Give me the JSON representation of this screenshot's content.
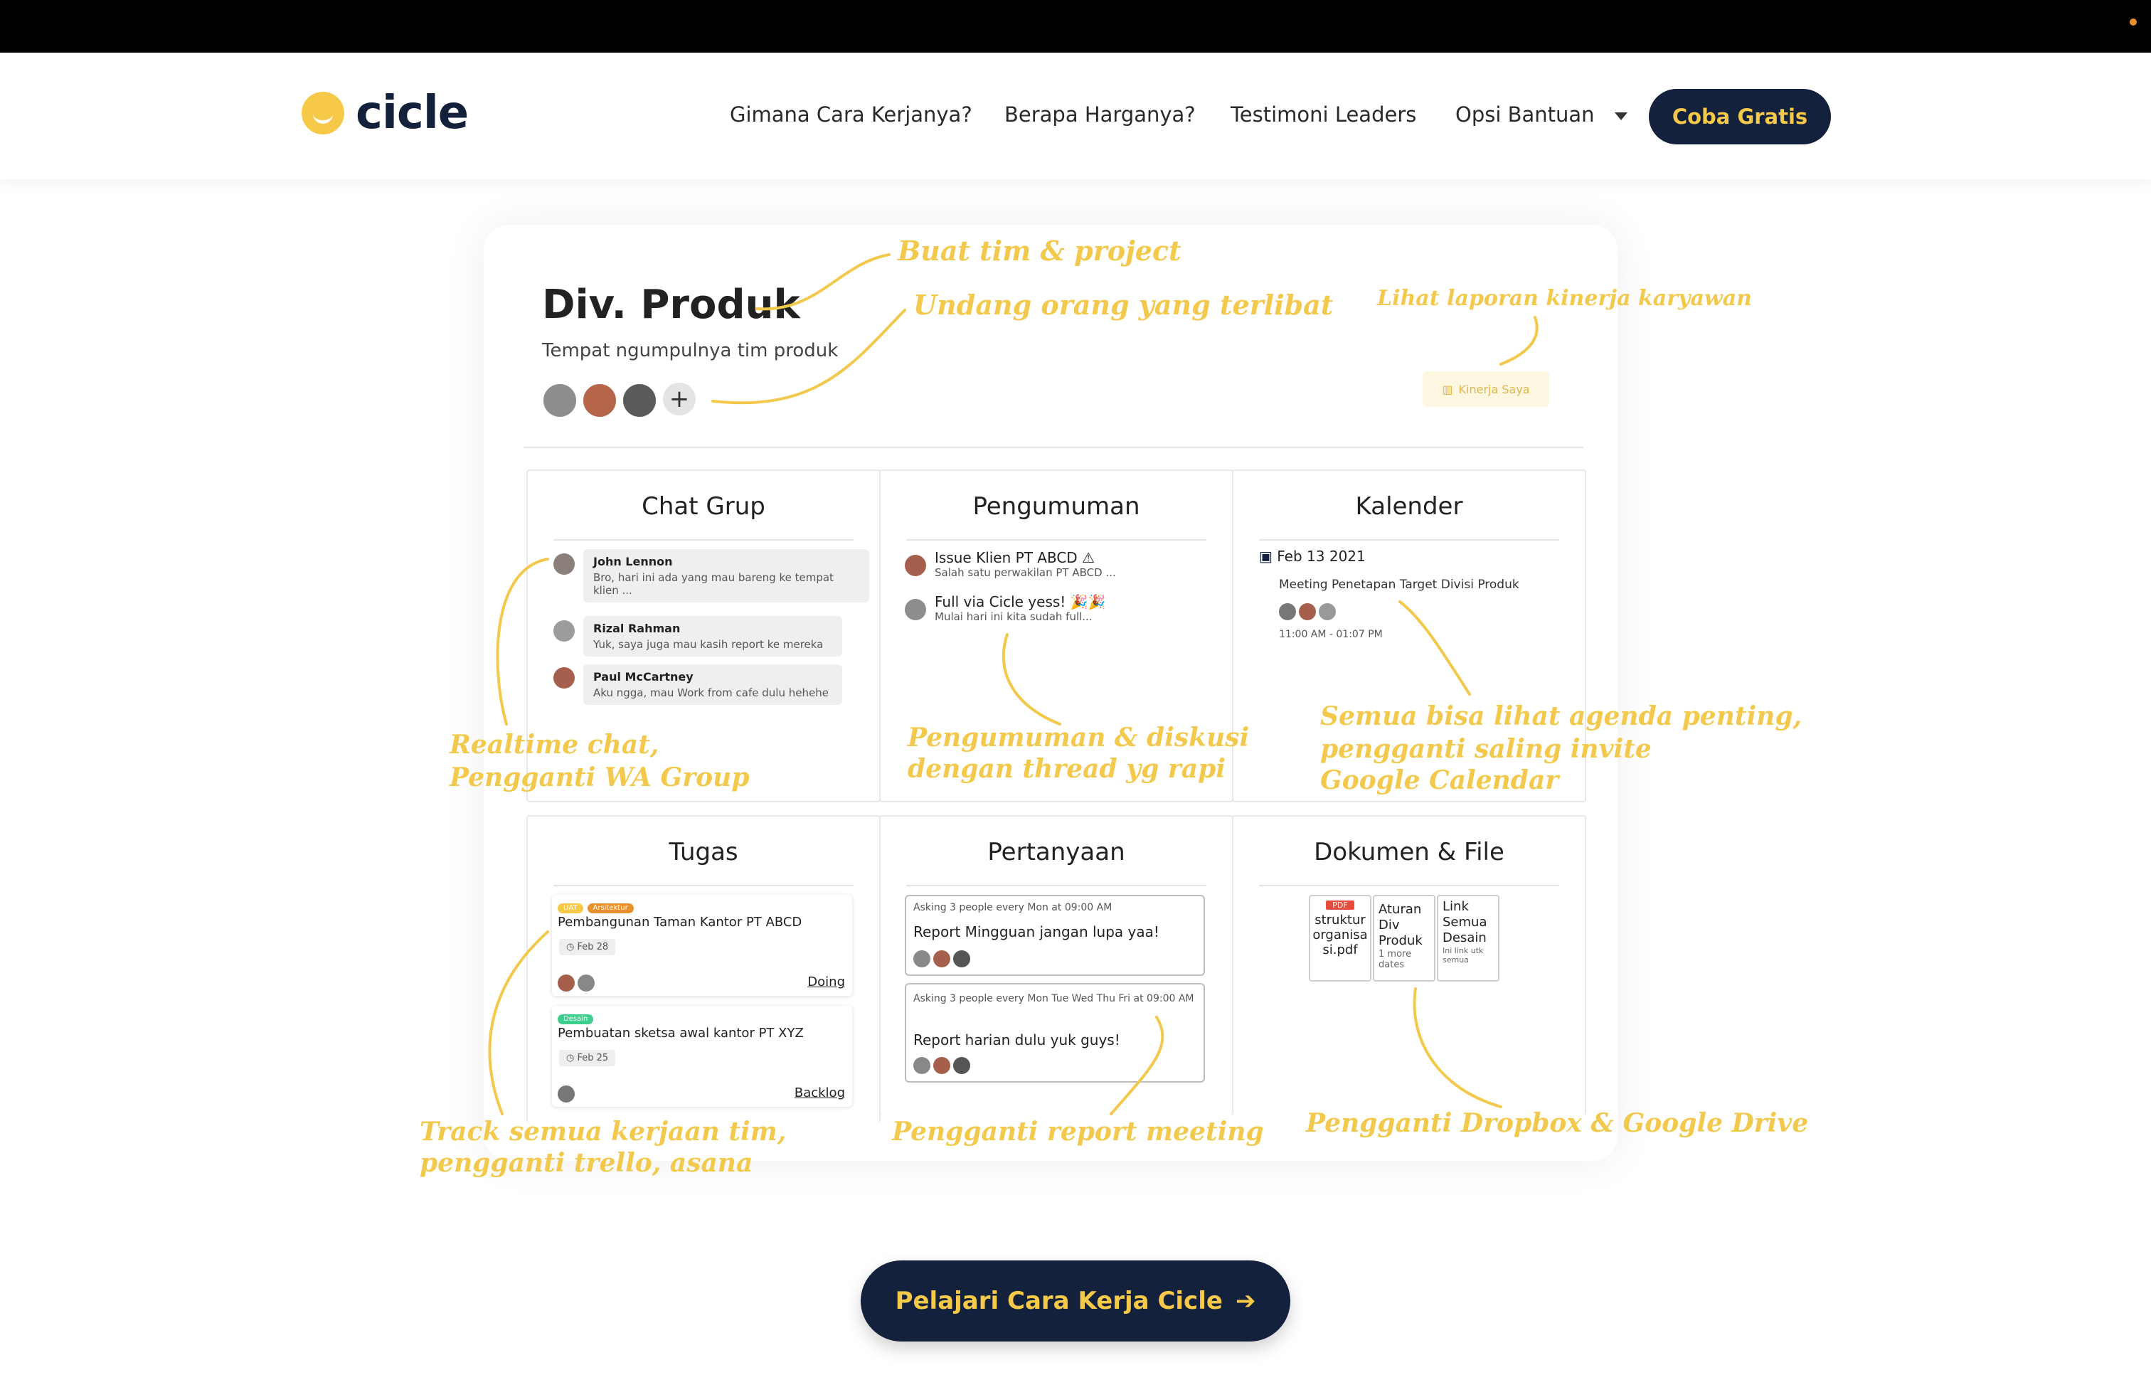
{
  "colors": {
    "yellow": "#f7c948",
    "navy": "#14213d",
    "pdf_red": "#e74c3c",
    "orange_dot": "#e8902c",
    "accent_annotation": "#f2c94c"
  },
  "logo": {
    "text": "cicle",
    "icon": "smile-logo-icon"
  },
  "nav": {
    "items": [
      "Gimana Cara Kerjanya?",
      "Berapa Harganya?",
      "Testimoni Leaders",
      "Opsi Bantuan"
    ],
    "cta": "Coba Gratis"
  },
  "team": {
    "title": "Div. Produk",
    "subtitle": "Tempat ngumpulnya tim produk",
    "kinerja_button": "Kinerja Saya"
  },
  "panels": {
    "chat": {
      "title": "Chat Grup",
      "messages": [
        {
          "name": "John Lennon",
          "text": "Bro, hari ini ada yang mau bareng ke tempat klien ..."
        },
        {
          "name": "Rizal Rahman",
          "text": "Yuk, saya juga mau kasih report ke mereka"
        },
        {
          "name": "Paul McCartney",
          "text": "Aku ngga, mau Work from cafe dulu hehehe"
        }
      ]
    },
    "pengumuman": {
      "title": "Pengumuman",
      "items": [
        {
          "title": "Issue Klien PT ABCD ⚠",
          "text": "Salah satu perwakilan PT ABCD ..."
        },
        {
          "title": "Full via Cicle yess! 🎉🎉",
          "text": "Mulai hari ini kita sudah full..."
        }
      ]
    },
    "kalender": {
      "title": "Kalender",
      "date": "Feb 13 2021",
      "event": "Meeting Penetapan Target Divisi Produk",
      "time": "11:00 AM - 01:07 PM"
    },
    "tugas": {
      "title": "Tugas",
      "tasks": [
        {
          "tags": [
            "UAT",
            "Arsitektur"
          ],
          "title": "Pembangunan Taman Kantor PT ABCD",
          "date": "Feb 28",
          "status": "Doing"
        },
        {
          "tags": [
            "Desain"
          ],
          "title": "Pembuatan sketsa awal kantor PT XYZ",
          "date": "Feb 25",
          "status": "Backlog"
        }
      ]
    },
    "pertanyaan": {
      "title": "Pertanyaan",
      "items": [
        {
          "schedule": "Asking 3 people every Mon at 09:00 AM",
          "question": "Report Mingguan jangan lupa yaa!"
        },
        {
          "schedule": "Asking 3 people every Mon Tue Wed Thu Fri at 09:00 AM",
          "question": "Report harian dulu yuk guys!"
        }
      ]
    },
    "dokumen": {
      "title": "Dokumen & File",
      "files": [
        {
          "badge": "PDF",
          "name": "struktur organisasi.pdf"
        },
        {
          "name": "Aturan Div Produk",
          "meta": "1 more dates"
        },
        {
          "name": "Link Semua Desain",
          "meta": "Ini link utk semua"
        }
      ]
    }
  },
  "annotations": {
    "buat_tim": "Buat tim & project",
    "undang": "Undang orang yang terlibat",
    "laporan": "Lihat laporan kinerja karyawan",
    "chat_1": "Realtime chat,",
    "chat_2": "Pengganti WA Group",
    "pengumuman_1": "Pengumuman & diskusi",
    "pengumuman_2": "dengan thread yg rapi",
    "kalender_1": "Semua bisa lihat agenda penting,",
    "kalender_2": "pengganti saling invite",
    "kalender_3": "Google Calendar",
    "tugas_1": "Track semua kerjaan tim,",
    "tugas_2": "pengganti trello, asana",
    "pertanyaan": "Pengganti report meeting",
    "dokumen": "Pengganti Dropbox & Google Drive"
  },
  "cta_bottom": "Pelajari Cara Kerja Cicle"
}
